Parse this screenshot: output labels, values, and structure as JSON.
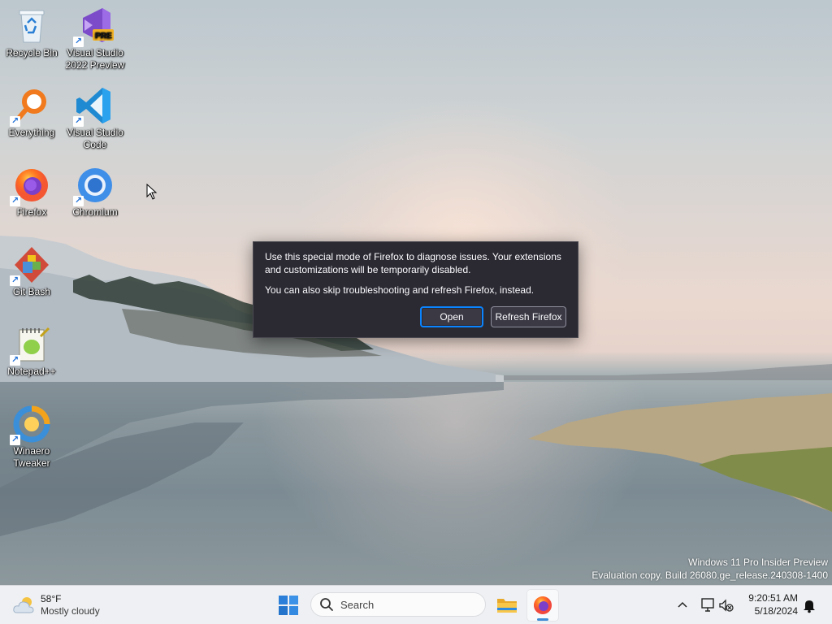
{
  "desktop": {
    "icons": [
      {
        "label": "Recycle Bin",
        "icon": "recycle-bin-icon"
      },
      {
        "label": "Visual Studio 2022 Preview",
        "icon": "visual-studio-icon",
        "badge": "PRE"
      },
      {
        "label": "Everything",
        "icon": "everything-search-icon"
      },
      {
        "label": "Visual Studio Code",
        "icon": "vscode-icon"
      },
      {
        "label": "Firefox",
        "icon": "firefox-icon"
      },
      {
        "label": "Chromium",
        "icon": "chromium-icon"
      },
      {
        "label": "Git Bash",
        "icon": "git-bash-icon"
      },
      {
        "label": "Notepad++",
        "icon": "notepad-plus-plus-icon"
      },
      {
        "label": "Winaero Tweaker",
        "icon": "winaero-tweaker-icon"
      }
    ]
  },
  "dialog": {
    "message1": "Use this special mode of Firefox to diagnose issues. Your extensions and customizations will be temporarily disabled.",
    "message2": "You can also skip troubleshooting and refresh Firefox, instead.",
    "open_label": "Open",
    "refresh_label": "Refresh Firefox"
  },
  "watermark": {
    "line1": "Windows 11 Pro Insider Preview",
    "line2": "Evaluation copy. Build 26080.ge_release.240308-1400"
  },
  "taskbar": {
    "weather": {
      "temp": "58°F",
      "condition": "Mostly cloudy"
    },
    "search_placeholder": "Search",
    "clock": {
      "time": "9:20:51 AM",
      "date": "5/18/2024"
    }
  }
}
